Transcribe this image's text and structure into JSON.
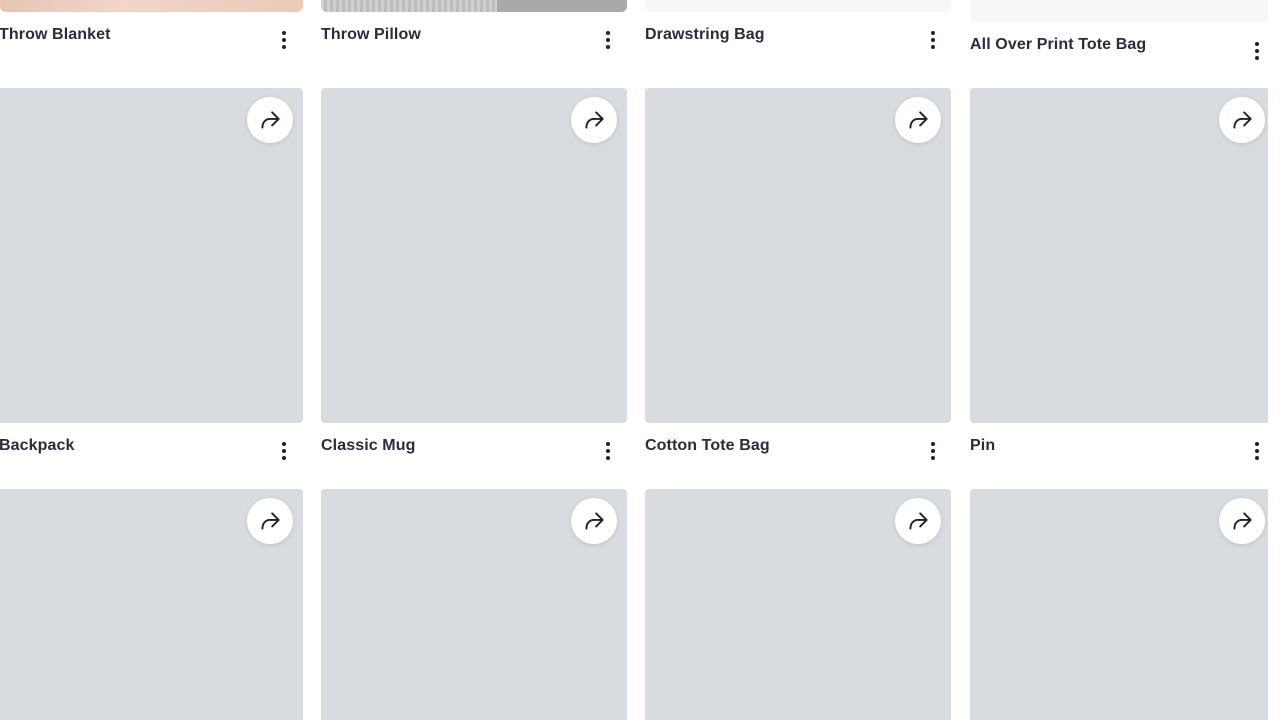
{
  "products": {
    "row1": [
      {
        "title": "Throw Blanket"
      },
      {
        "title": "Throw Pillow"
      },
      {
        "title": "Drawstring Bag"
      },
      {
        "title": "All Over Print Tote Bag"
      }
    ],
    "row2": [
      {
        "title": "Backpack"
      },
      {
        "title": "Classic Mug"
      },
      {
        "title": "Cotton Tote Bag"
      },
      {
        "title": "Pin"
      }
    ]
  },
  "icons": {
    "share": "share-icon",
    "more": "more-vertical-icon"
  },
  "colors": {
    "image_placeholder": "#d8dbdf",
    "title_text": "#2a2b3d",
    "icon": "#1f2030"
  }
}
